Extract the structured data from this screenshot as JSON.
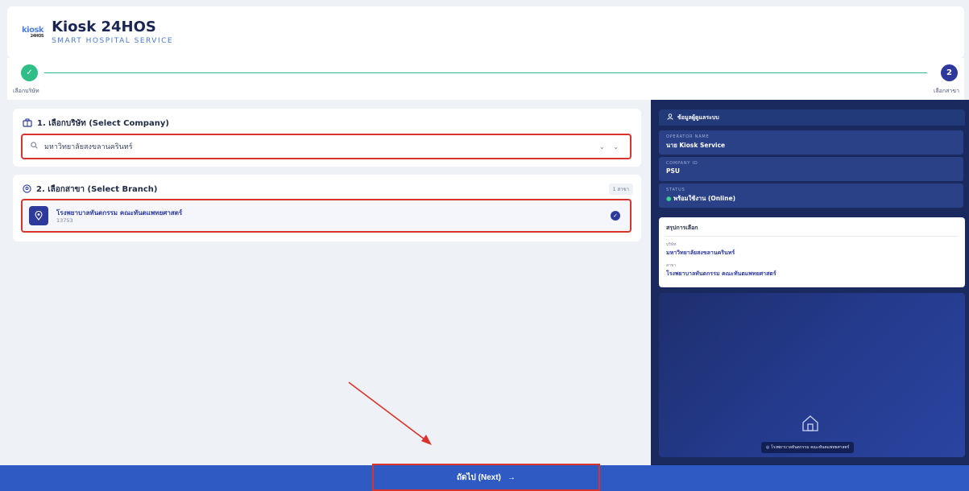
{
  "header": {
    "logo_text": "kiosk",
    "logo_sub": "24HOS",
    "title": "Kiosk 24HOS",
    "subtitle": "SMART HOSPITAL SERVICE"
  },
  "stepper": {
    "steps": [
      {
        "label": "เลือกบริษัท",
        "state": "done",
        "marker": "✓"
      },
      {
        "label": "เลือกสาขา",
        "state": "active",
        "marker": "2"
      }
    ]
  },
  "company_section": {
    "title": "1. เลือกบริษัท (Select Company)",
    "selected_value": "มหาวิทยาลัยสงขลานครินทร์"
  },
  "branch_section": {
    "title": "2. เลือกสาขา (Select Branch)",
    "count_badge": "1 สาขา",
    "items": [
      {
        "name": "โรงพยาบาลทันตกรรม คณะทันตแพทยศาสตร์",
        "code": "13753",
        "selected": true
      }
    ]
  },
  "operator_panel": {
    "title": "ข้อมูลผู้ดูแลระบบ",
    "fields": [
      {
        "label": "OPERATOR NAME",
        "value": "นาย Kiosk Service"
      },
      {
        "label": "COMPANY ID",
        "value": "PSU"
      },
      {
        "label": "STATUS",
        "value": "พร้อมใช้งาน (Online)"
      }
    ]
  },
  "summary": {
    "title": "สรุปการเลือก",
    "company_label": "บริษัท",
    "company_value": "มหาวิทยาลัยสงขลานครินทร์",
    "branch_label": "สาขา",
    "branch_value": "โรงพยาบาลทันตกรรม คณะทันตแพทยศาสตร์"
  },
  "visual": {
    "caption": "โรงพยาบาลทันตกรรม คณะทันตแพทยศาสตร์"
  },
  "footer": {
    "next_label": "ถัดไป (Next)",
    "next_arrow": "→"
  },
  "colors": {
    "primary": "#2d3a9c",
    "success": "#2fbf86",
    "highlight": "#d9342b",
    "footer": "#2f5ac4"
  }
}
